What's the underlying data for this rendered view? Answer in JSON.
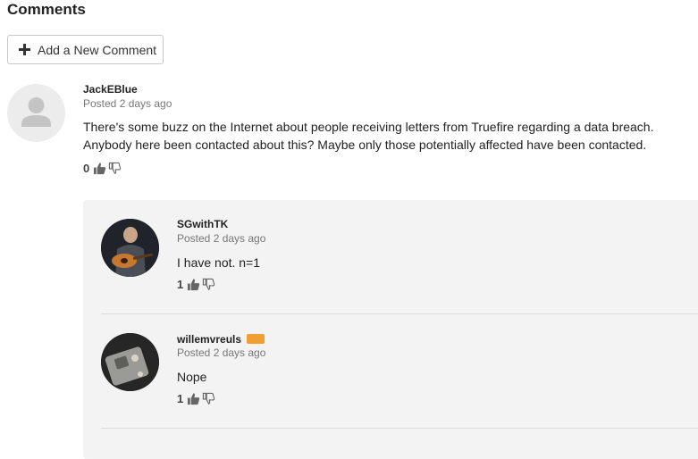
{
  "section": {
    "title": "Comments"
  },
  "add_button": {
    "label": "Add a New Comment"
  },
  "comments": [
    {
      "author": "JackEBlue",
      "time": "Posted 2 days ago",
      "body_line1": "There's some buzz on the Internet about people receiving letters from Truefire regarding a data breach.",
      "body_line2": "Anybody here been contacted about this? Maybe only those potentially affected have been contacted.",
      "votes": "0"
    }
  ],
  "replies": [
    {
      "author": "SGwithTK",
      "time": "Posted 2 days ago",
      "body": "I have not. n=1",
      "votes": "1"
    },
    {
      "author": "willemvreuls",
      "time": "Posted 2 days ago",
      "body": "Nope",
      "votes": "1"
    }
  ],
  "colors": {
    "badge": "#f0a030",
    "reply_bg": "#f3f3f3"
  }
}
